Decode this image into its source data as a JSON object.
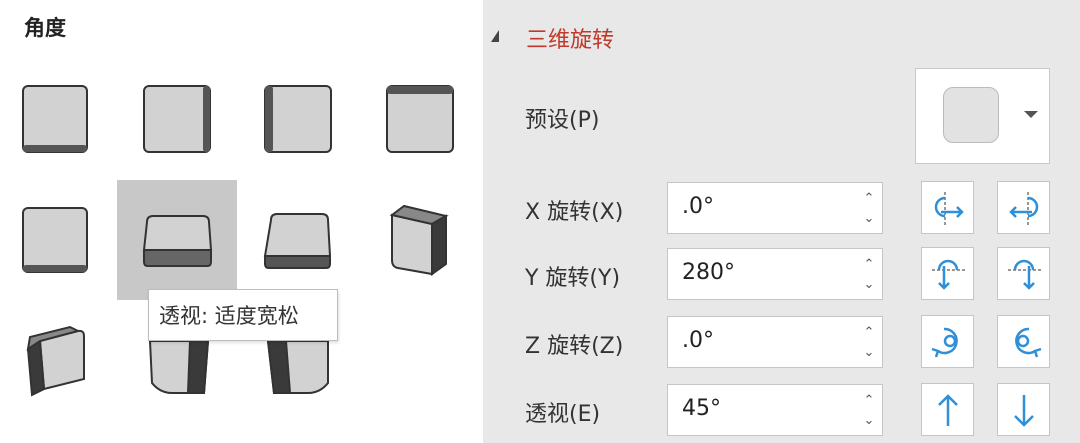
{
  "left_panel": {
    "title": "角度",
    "presets": [
      {
        "name": "preset-front-bottom-edge"
      },
      {
        "name": "preset-front-right-edge"
      },
      {
        "name": "preset-front-left-edge"
      },
      {
        "name": "preset-front-top-edge"
      },
      {
        "name": "preset-front-bottom-edge-2"
      },
      {
        "name": "preset-perspective-relaxed"
      },
      {
        "name": "preset-perspective-bottom"
      },
      {
        "name": "preset-isometric-right"
      },
      {
        "name": "preset-isometric-left"
      },
      {
        "name": "preset-tilt-left"
      },
      {
        "name": "preset-tilt-right"
      }
    ],
    "tooltip": "透视: 适度宽松"
  },
  "right_panel": {
    "section_title": "三维旋转",
    "preset_label": "预设(P)",
    "x_label": "X 旋转(X)",
    "x_value": ".0°",
    "y_label": "Y 旋转(Y)",
    "y_value": "280°",
    "z_label": "Z 旋转(Z)",
    "z_value": ".0°",
    "p_label": "透视(E)",
    "p_value": "45°",
    "spin_up": "⌃",
    "spin_down": "⌄"
  },
  "colors": {
    "accent_red": "#c0392b",
    "icon_blue": "#2f8fd8",
    "panel_bg": "#e8e8e8",
    "hover_bg": "#c8c8c8"
  }
}
